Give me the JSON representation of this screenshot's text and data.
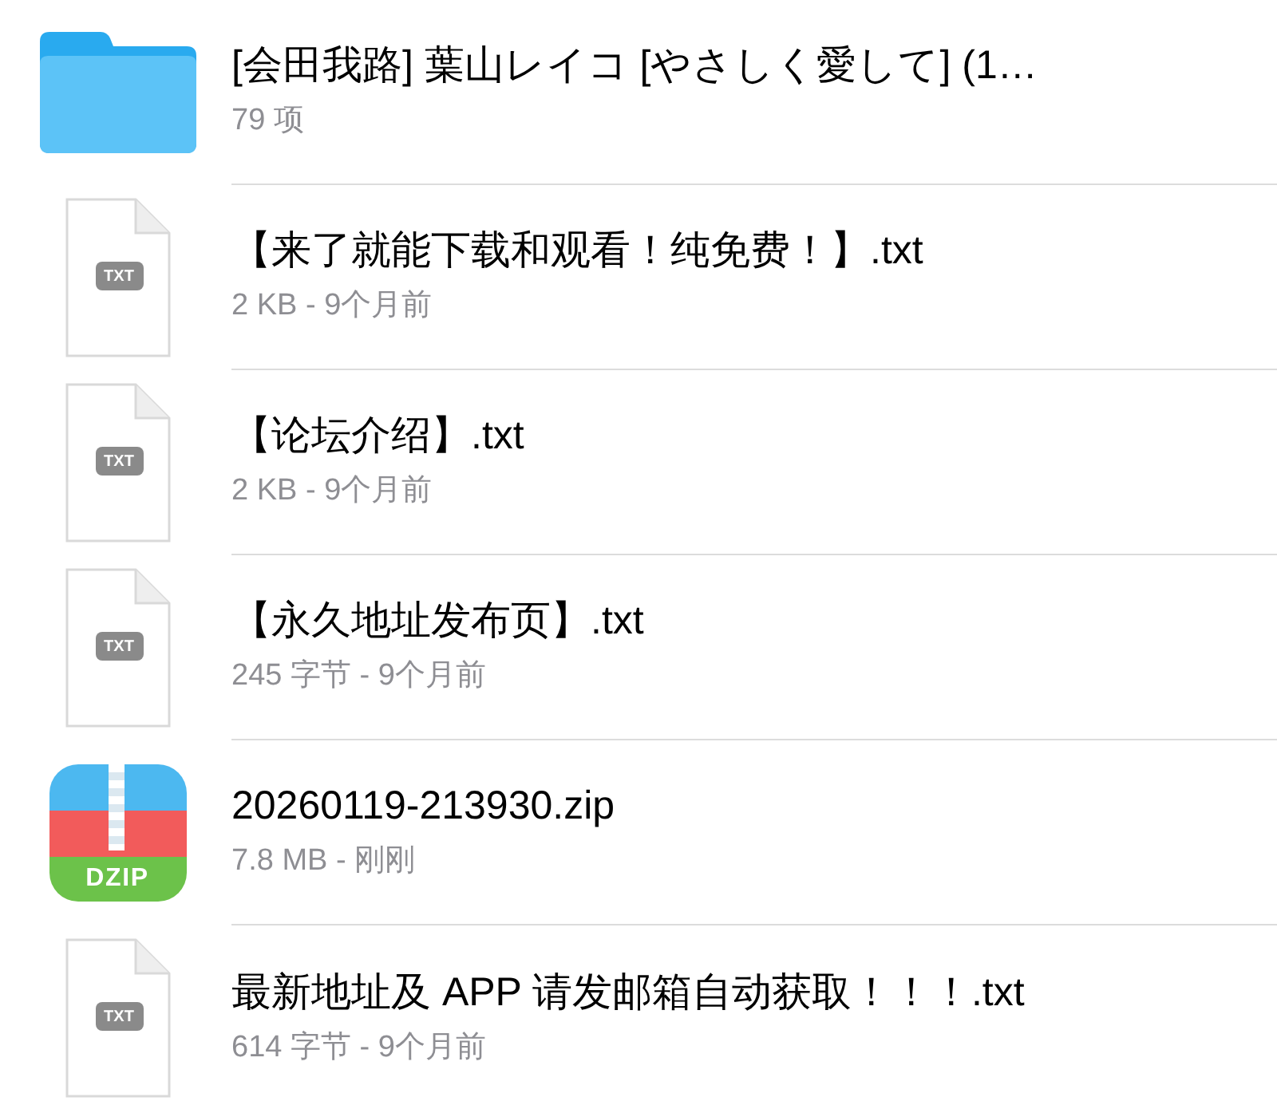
{
  "files": [
    {
      "kind": "folder",
      "name": "[会田我路] 葉山レイコ [やさしく愛して] (1…",
      "meta": "79 项"
    },
    {
      "kind": "txt",
      "icon_label": "TXT",
      "name": "【来了就能下载和观看！纯免费！】.txt",
      "meta": "2 KB - 9个月前"
    },
    {
      "kind": "txt",
      "icon_label": "TXT",
      "name": "【论坛介绍】.txt",
      "meta": "2 KB - 9个月前"
    },
    {
      "kind": "txt",
      "icon_label": "TXT",
      "name": "【永久地址发布页】.txt",
      "meta": "245 字节 - 9个月前"
    },
    {
      "kind": "zip",
      "icon_label": "DZIP",
      "name": "20260119-213930.zip",
      "meta": "7.8 MB - 刚刚"
    },
    {
      "kind": "txt",
      "icon_label": "TXT",
      "name": "最新地址及 APP 请发邮箱自动获取！！！.txt",
      "meta": "614 字节 - 9个月前"
    }
  ]
}
